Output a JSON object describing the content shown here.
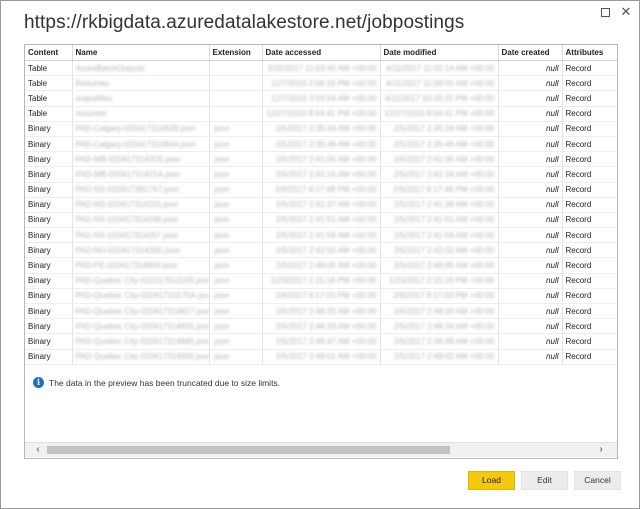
{
  "window": {
    "title": "https://rkbigdata.azuredatalakestore.net/jobpostings",
    "restore_icon": "restore-icon",
    "close_icon": "close-icon",
    "close_glyph": "✕"
  },
  "table": {
    "columns": [
      "Content",
      "Name",
      "Extension",
      "Date accessed",
      "Date modified",
      "Date created",
      "Attributes"
    ],
    "rows": [
      {
        "content": "Table",
        "name": "AzureBatchOutputs",
        "extension": "",
        "accessed": "2/20/2017 11:03:45 AM +00:00",
        "modified": "4/11/2017 11:02:14 AM +00:00",
        "created": "null",
        "attributes": "Record"
      },
      {
        "content": "Table",
        "name": "Resumes",
        "extension": "",
        "accessed": "12/7/2016 2:06:19 PM +00:00",
        "modified": "4/11/2017 11:08:55 AM +00:00",
        "created": "null",
        "attributes": "Record"
      },
      {
        "content": "Table",
        "name": "outputfiles",
        "extension": "",
        "accessed": "12/7/2016 3:55:54 AM +00:00",
        "modified": "4/11/2017 10:20:15 PM +00:00",
        "created": "null",
        "attributes": "Record"
      },
      {
        "content": "Table",
        "name": "resumes",
        "extension": "",
        "accessed": "12/27/2016 8:54:41 PM +00:00",
        "modified": "12/27/2016 8:54:41 PM +00:00",
        "created": "null",
        "attributes": "Record"
      },
      {
        "content": "Binary",
        "name": "PAD-Calgary-02041731092B.json",
        "extension": ".json",
        "accessed": "2/5/2017 2:35:34 AM +00:00",
        "modified": "2/5/2017 2:35:34 AM +00:00",
        "created": "null",
        "attributes": "Record"
      },
      {
        "content": "Binary",
        "name": "PAD-Calgary-02041731094A.json",
        "extension": ".json",
        "accessed": "2/5/2017 2:35:46 AM +00:00",
        "modified": "2/5/2017 2:35:46 AM +00:00",
        "created": "null",
        "attributes": "Record"
      },
      {
        "content": "Binary",
        "name": "PAD-MB-0204173142D5.json",
        "extension": ".json",
        "accessed": "2/5/2017 2:41:05 AM +00:00",
        "modified": "2/5/2017 2:41:05 AM +00:00",
        "created": "null",
        "attributes": "Record"
      },
      {
        "content": "Binary",
        "name": "PAD-MB-02041731421A.json",
        "extension": ".json",
        "accessed": "2/5/2017 2:41:16 AM +00:00",
        "modified": "2/5/2017 2:41:16 AM +00:00",
        "created": "null",
        "attributes": "Record"
      },
      {
        "content": "Binary",
        "name": "PAD-NS-0204173817A7.json",
        "extension": ".json",
        "accessed": "2/6/2017 8:17:48 PM +00:00",
        "modified": "2/6/2017 8:17:48 PM +00:00",
        "created": "null",
        "attributes": "Record"
      },
      {
        "content": "Binary",
        "name": "PAD-NS-020417314215.json",
        "extension": ".json",
        "accessed": "2/5/2017 2:41:37 AM +00:00",
        "modified": "2/5/2017 2:41:38 AM +00:00",
        "created": "null",
        "attributes": "Record"
      },
      {
        "content": "Binary",
        "name": "PAD-NS-020417314248.json",
        "extension": ".json",
        "accessed": "2/5/2017 2:41:51 AM +00:00",
        "modified": "2/5/2017 2:41:51 AM +00:00",
        "created": "null",
        "attributes": "Record"
      },
      {
        "content": "Binary",
        "name": "PAD-NS-020417314257.json",
        "extension": ".json",
        "accessed": "2/5/2017 2:41:59 AM +00:00",
        "modified": "2/5/2017 2:41:59 AM +00:00",
        "created": "null",
        "attributes": "Record"
      },
      {
        "content": "Binary",
        "name": "PAD-NU-02041731420D.json",
        "extension": ".json",
        "accessed": "2/5/2017 2:42:02 AM +00:00",
        "modified": "2/5/2017 2:42:02 AM +00:00",
        "created": "null",
        "attributes": "Record"
      },
      {
        "content": "Binary",
        "name": "PAD-PE-020417314804.json",
        "extension": ".json",
        "accessed": "2/5/2017 2:48:05 AM +00:00",
        "modified": "2/5/2017 2:48:05 AM +00:00",
        "created": "null",
        "attributes": "Record"
      },
      {
        "content": "Binary",
        "name": "PAD-Quebec City-012317913155.json",
        "extension": ".json",
        "accessed": "1/23/2017 2:15:16 PM +00:00",
        "modified": "1/23/2017 2:15:16 PM +00:00",
        "created": "null",
        "attributes": "Record"
      },
      {
        "content": "Binary",
        "name": "PAD-Quebec City-02041731E75A.json",
        "extension": ".json",
        "accessed": "2/6/2017 9:17:03 PM +00:00",
        "modified": "2/6/2017 9:17:03 PM +00:00",
        "created": "null",
        "attributes": "Record"
      },
      {
        "content": "Binary",
        "name": "PAD-Quebec City-020417314817.json",
        "extension": ".json",
        "accessed": "2/5/2017 2:48:20 AM +00:00",
        "modified": "2/5/2017 2:48:20 AM +00:00",
        "created": "null",
        "attributes": "Record"
      },
      {
        "content": "Binary",
        "name": "PAD-Quebec City-020417314831.json",
        "extension": ".json",
        "accessed": "2/5/2017 2:48:33 AM +00:00",
        "modified": "2/5/2017 2:48:34 AM +00:00",
        "created": "null",
        "attributes": "Record"
      },
      {
        "content": "Binary",
        "name": "PAD-Quebec City-020417314845.json",
        "extension": ".json",
        "accessed": "2/5/2017 2:48:47 AM +00:00",
        "modified": "2/5/2017 2:48:48 AM +00:00",
        "created": "null",
        "attributes": "Record"
      },
      {
        "content": "Binary",
        "name": "PAD-Quebec City-020417314900.json",
        "extension": ".json",
        "accessed": "2/5/2017 2:49:01 AM +00:00",
        "modified": "2/5/2017 2:49:02 AM +00:00",
        "created": "null",
        "attributes": "Record"
      }
    ]
  },
  "info": {
    "icon": "info-icon",
    "icon_glyph": "i",
    "message": "The data in the preview has been truncated due to size limits."
  },
  "scrollbar": {
    "left_arrow": "‹",
    "right_arrow": "›"
  },
  "buttons": {
    "load": "Load",
    "edit": "Edit",
    "cancel": "Cancel"
  },
  "colors": {
    "load_button": "#f2c811",
    "info_icon": "#1f6fbf"
  }
}
